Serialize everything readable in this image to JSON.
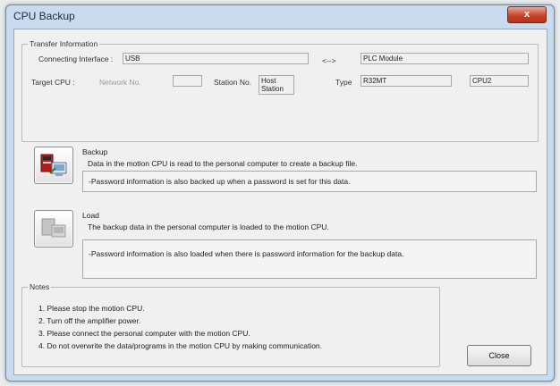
{
  "window": {
    "title": "CPU Backup",
    "close_glyph": "x"
  },
  "transfer": {
    "legend": "Transfer Information",
    "connecting_label": "Connecting Interface :",
    "connecting_value": "USB",
    "arrow": "<-->",
    "plc_value": "PLC Module",
    "target_label": "Target CPU :",
    "network_label": "Network No.",
    "network_value": "",
    "station_label": "Station No.",
    "station_value": "Host\nStation",
    "type_label": "Type",
    "type_value": "R32MT",
    "cpu_value": "CPU2"
  },
  "backup": {
    "icon": "backup-icon",
    "title": "Backup",
    "description": "Data in the motion CPU is read to the personal computer to create a backup file.",
    "password_note": "-Password information is also backed up when a password is set for this data."
  },
  "load": {
    "icon": "load-icon",
    "title": "Load",
    "description": "The backup data in the personal computer is loaded to the motion CPU.",
    "password_note": "-Password information is also loaded when there is password information for the backup data."
  },
  "notes": {
    "legend": "Notes",
    "items": [
      "1. Please stop the motion CPU.",
      "2. Turn off the amplifier power.",
      "3. Please connect the personal computer with the motion CPU.",
      "4. Do not overwrite the data/programs in the motion CPU by making communication."
    ]
  },
  "buttons": {
    "close": "Close"
  }
}
